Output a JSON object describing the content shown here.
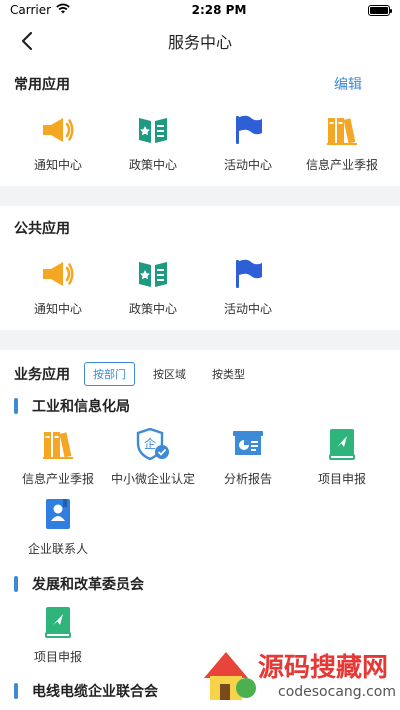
{
  "status_bar": {
    "carrier": "Carrier",
    "time": "2:28 PM"
  },
  "nav": {
    "title": "服务中心"
  },
  "common_apps": {
    "title": "常用应用",
    "edit_label": "编辑",
    "items": [
      {
        "label": "通知中心",
        "icon": "megaphone-icon"
      },
      {
        "label": "政策中心",
        "icon": "policy-book-icon"
      },
      {
        "label": "活动中心",
        "icon": "flag-icon"
      },
      {
        "label": "信息产业季报",
        "icon": "books-icon"
      }
    ]
  },
  "public_apps": {
    "title": "公共应用",
    "items": [
      {
        "label": "通知中心",
        "icon": "megaphone-icon"
      },
      {
        "label": "政策中心",
        "icon": "policy-book-icon"
      },
      {
        "label": "活动中心",
        "icon": "flag-icon"
      }
    ]
  },
  "business_apps": {
    "title": "业务应用",
    "tabs": [
      {
        "label": "按部门",
        "active": true
      },
      {
        "label": "按区域",
        "active": false
      },
      {
        "label": "按类型",
        "active": false
      }
    ],
    "groups": [
      {
        "title": "工业和信息化局",
        "items": [
          {
            "label": "信息产业季报",
            "icon": "books-icon"
          },
          {
            "label": "中小微企业认定",
            "icon": "enterprise-shield-icon"
          },
          {
            "label": "分析报告",
            "icon": "report-chart-icon"
          },
          {
            "label": "项目申报",
            "icon": "project-book-icon"
          },
          {
            "label": "企业联系人",
            "icon": "contact-book-icon"
          }
        ]
      },
      {
        "title": "发展和改革委员会",
        "items": [
          {
            "label": "项目申报",
            "icon": "project-book-icon"
          }
        ]
      },
      {
        "title": "电线电缆企业联合会",
        "items": []
      }
    ]
  },
  "watermark": {
    "name": "源码搜藏网",
    "url": "codesocang.com"
  },
  "colors": {
    "accent_blue": "#3d8ad6",
    "orange": "#f5a623",
    "teal": "#1e9a82",
    "flag_blue": "#2f5fd6",
    "green": "#2fb47c"
  }
}
